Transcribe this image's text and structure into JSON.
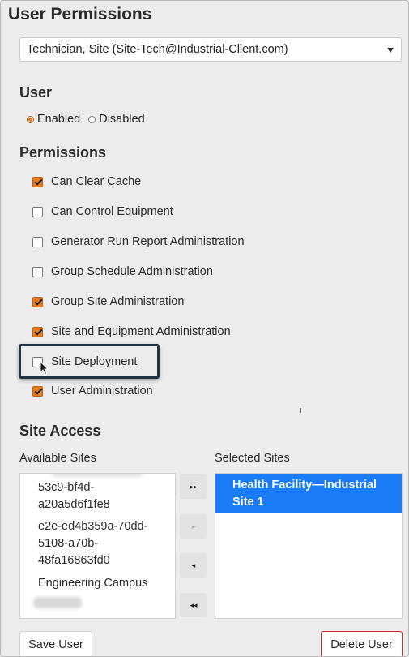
{
  "page": {
    "title": "User Permissions"
  },
  "user_select": {
    "selected": "Technician, Site (Site-Tech@Industrial-Client.com)"
  },
  "user_section": {
    "heading": "User",
    "options": [
      {
        "label": "Enabled",
        "selected": true
      },
      {
        "label": "Disabled",
        "selected": false
      }
    ]
  },
  "permissions": {
    "heading": "Permissions",
    "items": [
      {
        "label": "Can Clear Cache",
        "checked": true
      },
      {
        "label": "Can Control Equipment",
        "checked": false
      },
      {
        "label": "Generator Run Report Administration",
        "checked": false
      },
      {
        "label": "Group Schedule Administration",
        "checked": false
      },
      {
        "label": "Group Site Administration",
        "checked": true
      },
      {
        "label": "Site and Equipment Administration",
        "checked": true
      },
      {
        "label": "Site Deployment",
        "checked": false
      },
      {
        "label": "User Administration",
        "checked": true
      }
    ]
  },
  "site_access": {
    "heading": "Site Access",
    "available_label": "Available Sites",
    "selected_label": "Selected Sites",
    "available": [
      {
        "line1": "53c9-bf4d-",
        "line2": "a20a5d6f1fe8"
      },
      {
        "line1": "e2e-ed4b359a-70dd-",
        "line2": "5108-a70b-",
        "line3": "48fa16863fd0"
      },
      {
        "line1": "Engineering Campus"
      }
    ],
    "selected": [
      {
        "line1": "Health Facility—Industrial",
        "line2": "Site 1"
      }
    ],
    "buttons": {
      "add_all": "▸▸",
      "add": "▸",
      "remove": "◂",
      "remove_all": "◂◂"
    }
  },
  "actions": {
    "save": "Save User",
    "delete": "Delete User"
  },
  "colors": {
    "accent": "#e8791e",
    "selected_bg": "#1a7cf6",
    "delete_border": "#c62a2a"
  }
}
